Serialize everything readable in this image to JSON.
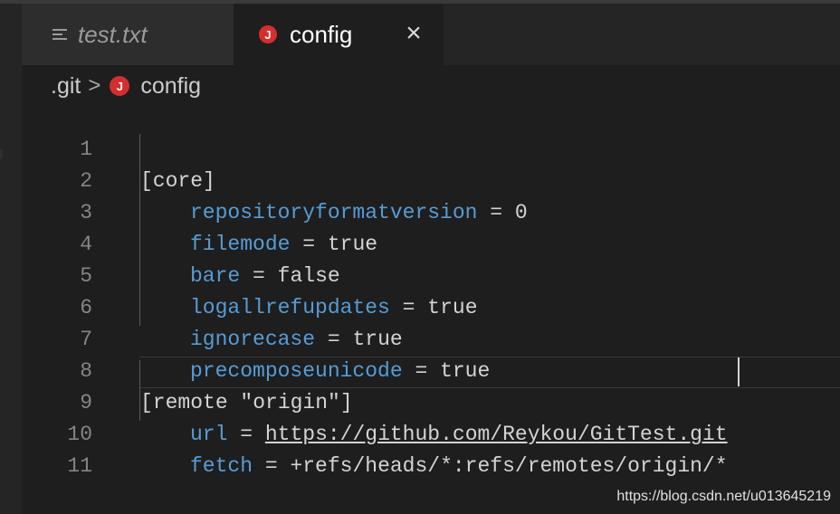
{
  "tabs": [
    {
      "label": "test.txt",
      "icon": "text-lines-icon",
      "active": false
    },
    {
      "label": "config",
      "icon": "config-j-icon",
      "active": true
    }
  ],
  "close_symbol": "×",
  "breadcrumb": {
    "folder": ".git",
    "separator": ">",
    "file": "config"
  },
  "editor": {
    "lines": [
      {
        "num": "1",
        "section": "[core]"
      },
      {
        "num": "2",
        "key": "repositoryformatversion",
        "value": "0"
      },
      {
        "num": "3",
        "key": "filemode",
        "value": "true"
      },
      {
        "num": "4",
        "key": "bare",
        "value": "false"
      },
      {
        "num": "5",
        "key": "logallrefupdates",
        "value": "true"
      },
      {
        "num": "6",
        "key": "ignorecase",
        "value": "true"
      },
      {
        "num": "7",
        "key": "precomposeunicode",
        "value": "true"
      },
      {
        "num": "8",
        "section": "[remote \"origin\"]"
      },
      {
        "num": "9",
        "key": "url",
        "value": "https://github.com/Reykou/GitTest.git"
      },
      {
        "num": "10",
        "key": "fetch",
        "value": "+refs/heads/*:refs/remotes/origin/*"
      },
      {
        "num": "11"
      }
    ],
    "equals": "="
  },
  "watermark": "https://blog.csdn.net/u013645219",
  "colors": {
    "key": "#569cd6",
    "background": "#1e1e1e",
    "icon_red": "#d32f2f"
  }
}
